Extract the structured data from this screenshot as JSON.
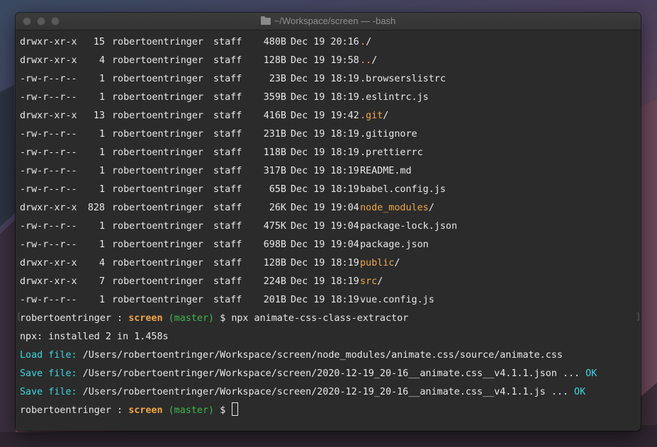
{
  "window": {
    "title": "~/Workspace/screen — -bash"
  },
  "listing": [
    {
      "perm": "drwxr-xr-x",
      "links": "15",
      "owner": "robertoentringer",
      "group": "staff",
      "size": "480B",
      "date": "Dec 19 20:16",
      "name": ".",
      "suffix": "/",
      "is_dir": true
    },
    {
      "perm": "drwxr-xr-x",
      "links": "4",
      "owner": "robertoentringer",
      "group": "staff",
      "size": "128B",
      "date": "Dec 19 19:58",
      "name": "..",
      "suffix": "/",
      "is_dir": true
    },
    {
      "perm": "-rw-r--r--",
      "links": "1",
      "owner": "robertoentringer",
      "group": "staff",
      "size": "23B",
      "date": "Dec 19 18:19",
      "name": ".browserslistrc",
      "suffix": "",
      "is_dir": false
    },
    {
      "perm": "-rw-r--r--",
      "links": "1",
      "owner": "robertoentringer",
      "group": "staff",
      "size": "359B",
      "date": "Dec 19 18:19",
      "name": ".eslintrc.js",
      "suffix": "",
      "is_dir": false
    },
    {
      "perm": "drwxr-xr-x",
      "links": "13",
      "owner": "robertoentringer",
      "group": "staff",
      "size": "416B",
      "date": "Dec 19 19:42",
      "name": ".git",
      "suffix": "/",
      "is_dir": true
    },
    {
      "perm": "-rw-r--r--",
      "links": "1",
      "owner": "robertoentringer",
      "group": "staff",
      "size": "231B",
      "date": "Dec 19 18:19",
      "name": ".gitignore",
      "suffix": "",
      "is_dir": false
    },
    {
      "perm": "-rw-r--r--",
      "links": "1",
      "owner": "robertoentringer",
      "group": "staff",
      "size": "118B",
      "date": "Dec 19 18:19",
      "name": ".prettierrc",
      "suffix": "",
      "is_dir": false
    },
    {
      "perm": "-rw-r--r--",
      "links": "1",
      "owner": "robertoentringer",
      "group": "staff",
      "size": "317B",
      "date": "Dec 19 18:19",
      "name": "README.md",
      "suffix": "",
      "is_dir": false
    },
    {
      "perm": "-rw-r--r--",
      "links": "1",
      "owner": "robertoentringer",
      "group": "staff",
      "size": "65B",
      "date": "Dec 19 18:19",
      "name": "babel.config.js",
      "suffix": "",
      "is_dir": false
    },
    {
      "perm": "drwxr-xr-x",
      "links": "828",
      "owner": "robertoentringer",
      "group": "staff",
      "size": "26K",
      "date": "Dec 19 19:04",
      "name": "node_modules",
      "suffix": "/",
      "is_dir": true
    },
    {
      "perm": "-rw-r--r--",
      "links": "1",
      "owner": "robertoentringer",
      "group": "staff",
      "size": "475K",
      "date": "Dec 19 19:04",
      "name": "package-lock.json",
      "suffix": "",
      "is_dir": false
    },
    {
      "perm": "-rw-r--r--",
      "links": "1",
      "owner": "robertoentringer",
      "group": "staff",
      "size": "698B",
      "date": "Dec 19 19:04",
      "name": "package.json",
      "suffix": "",
      "is_dir": false
    },
    {
      "perm": "drwxr-xr-x",
      "links": "4",
      "owner": "robertoentringer",
      "group": "staff",
      "size": "128B",
      "date": "Dec 19 18:19",
      "name": "public",
      "suffix": "/",
      "is_dir": true
    },
    {
      "perm": "drwxr-xr-x",
      "links": "7",
      "owner": "robertoentringer",
      "group": "staff",
      "size": "224B",
      "date": "Dec 19 18:19",
      "name": "src",
      "suffix": "/",
      "is_dir": true
    },
    {
      "perm": "-rw-r--r--",
      "links": "1",
      "owner": "robertoentringer",
      "group": "staff",
      "size": "201B",
      "date": "Dec 19 18:19",
      "name": "vue.config.js",
      "suffix": "",
      "is_dir": false
    }
  ],
  "prompt": {
    "user": "robertoentringer",
    "sep": " : ",
    "dir": "screen",
    "branch": "(master)",
    "symbol": "$"
  },
  "command": "npx animate-css-class-extractor",
  "output": {
    "installed": "npx: installed 2 in 1.458s",
    "load_label": "Load file:",
    "load_path": " /Users/robertoentringer/Workspace/screen/node_modules/animate.css/source/animate.css",
    "save1_label": "Save file:",
    "save1_path": " /Users/robertoentringer/Workspace/screen/2020-12-19_20-16__animate.css__v4.1.1.json ... ",
    "save2_label": "Save file:",
    "save2_path": " /Users/robertoentringer/Workspace/screen/2020-12-19_20-16__animate.css__v4.1.1.js ... ",
    "ok": "OK"
  },
  "colors": {
    "directory": "#f0a64a",
    "git_branch": "#3fb950",
    "info": "#3bd6e0",
    "text": "#e8e8e8"
  }
}
